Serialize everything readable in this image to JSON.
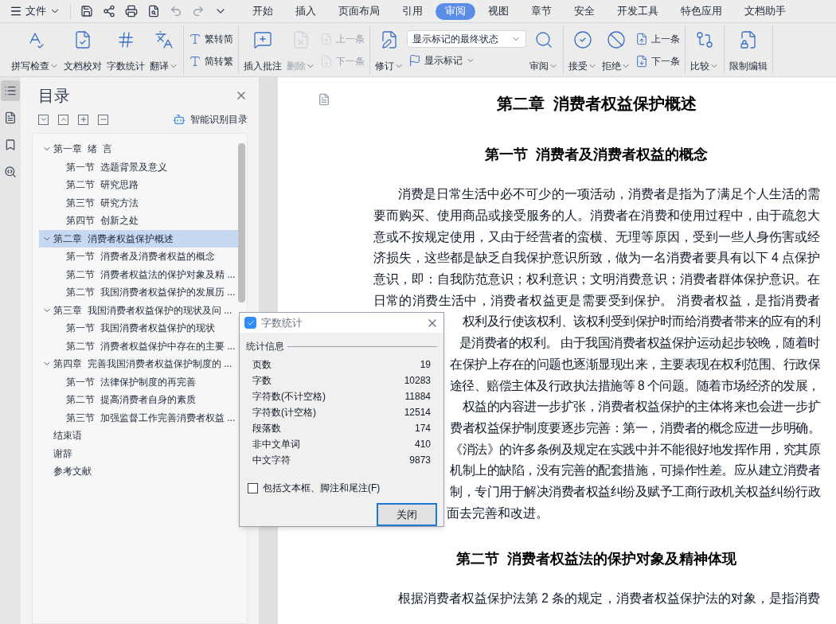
{
  "menu": {
    "file_label": "文件"
  },
  "tabs": [
    {
      "label": "开始",
      "selected": false
    },
    {
      "label": "插入",
      "selected": false
    },
    {
      "label": "页面布局",
      "selected": false
    },
    {
      "label": "引用",
      "selected": false
    },
    {
      "label": "审阅",
      "selected": true
    },
    {
      "label": "视图",
      "selected": false
    },
    {
      "label": "章节",
      "selected": false
    },
    {
      "label": "安全",
      "selected": false
    },
    {
      "label": "开发工具",
      "selected": false
    },
    {
      "label": "特色应用",
      "selected": false
    },
    {
      "label": "文档助手",
      "selected": false
    }
  ],
  "ribbon": [
    {
      "items": [
        {
          "kind": "large",
          "label": "拼写检查",
          "dropdown": true,
          "disabled": false
        },
        {
          "kind": "large",
          "label": "文档校对",
          "dropdown": false,
          "disabled": false
        },
        {
          "kind": "large",
          "label": "字数统计",
          "dropdown": false,
          "disabled": false
        },
        {
          "kind": "large",
          "label": "翻译",
          "dropdown": true,
          "disabled": false
        }
      ]
    },
    {
      "items": [
        {
          "kind": "small",
          "label": "繁转简",
          "dropdown": false,
          "disabled": false
        },
        {
          "kind": "small",
          "label": "简转繁",
          "dropdown": false,
          "disabled": false
        }
      ]
    },
    {
      "items": [
        {
          "kind": "large",
          "label": "插入批注",
          "dropdown": false,
          "disabled": false
        },
        {
          "kind": "large",
          "label": "删除",
          "dropdown": true,
          "disabled": true
        },
        {
          "kind": "small",
          "label": "上一条",
          "dropdown": false,
          "disabled": true
        },
        {
          "kind": "small",
          "label": "下一条",
          "dropdown": false,
          "disabled": true
        }
      ]
    },
    {
      "items": [
        {
          "kind": "large",
          "label": "修订",
          "dropdown": true,
          "disabled": false
        },
        {
          "kind": "select",
          "label": "显示标记的最终状态",
          "dropdown": true,
          "disabled": false
        },
        {
          "kind": "small",
          "label": "显示标记",
          "dropdown": true,
          "disabled": false
        },
        {
          "kind": "large",
          "label": "审阅",
          "dropdown": true,
          "disabled": false
        }
      ]
    },
    {
      "items": [
        {
          "kind": "large",
          "label": "接受",
          "dropdown": true,
          "disabled": false
        },
        {
          "kind": "large",
          "label": "拒绝",
          "dropdown": true,
          "disabled": false
        },
        {
          "kind": "small",
          "label": "上一条",
          "dropdown": false,
          "disabled": false
        },
        {
          "kind": "small",
          "label": "下一条",
          "dropdown": false,
          "disabled": false
        }
      ]
    },
    {
      "items": [
        {
          "kind": "large",
          "label": "比较",
          "dropdown": true,
          "disabled": false
        }
      ]
    },
    {
      "items": [
        {
          "kind": "large",
          "label": "限制编辑",
          "dropdown": false,
          "disabled": false
        }
      ]
    }
  ],
  "rail": [
    {
      "selected": true
    },
    {
      "selected": false
    },
    {
      "selected": false
    },
    {
      "selected": false
    }
  ],
  "toc": {
    "title": "目录",
    "smart_label": "智能识别目录",
    "items": [
      {
        "label": "第一章  绪  言",
        "selected": false,
        "expanded": true,
        "children": [
          {
            "label": "第一节  选题背景及意义",
            "selected": false
          },
          {
            "label": "第二节  研究思路",
            "selected": false
          },
          {
            "label": "第三节  研究方法",
            "selected": false
          },
          {
            "label": "第四节  创新之处",
            "selected": false
          }
        ]
      },
      {
        "label": "第二章  消费者权益保护概述",
        "selected": true,
        "expanded": true,
        "children": [
          {
            "label": "第一节  消费者及消费者权益的概念",
            "selected": false
          },
          {
            "label": "第二节  消费者权益法的保护对象及精 ...",
            "selected": false
          },
          {
            "label": "第二节  我国消费者权益保护的发展历 ...",
            "selected": false
          }
        ]
      },
      {
        "label": "第三章  我国消费者权益保护的现状及问 ...",
        "selected": false,
        "expanded": true,
        "children": [
          {
            "label": "第一节  我国消费者权益保护的现状",
            "selected": false
          },
          {
            "label": "第二节  消费者权益保护中存在的主要 ...",
            "selected": false
          }
        ]
      },
      {
        "label": "第四章  完善我国消费者权益保护制度的 ...",
        "selected": false,
        "expanded": true,
        "children": [
          {
            "label": "第一节  法律保护制度的再完善",
            "selected": false
          },
          {
            "label": "第二节  提高消费者自身的素质",
            "selected": false
          },
          {
            "label": "第三节  加强监督工作完善消费者权益 ...",
            "selected": false
          }
        ]
      },
      {
        "label": "结束语",
        "selected": false
      },
      {
        "label": "谢辞",
        "selected": false
      },
      {
        "label": "参考文献",
        "selected": false
      }
    ]
  },
  "document": [
    {
      "kind": "h1",
      "text": "第二章  消费者权益保护概述"
    },
    {
      "kind": "h2",
      "text": "第一节  消费者及消费者权益的概念"
    },
    {
      "kind": "para",
      "lines": [
        {
          "kind": "first",
          "text": "消费是日常生活中必不可少的一项活动，消费者是指为了满足个人生活的需"
        },
        {
          "kind": "full",
          "text": "要而购买、使用商品或接受服务的人。消费者在消费和使用过程中，由于疏忽大"
        },
        {
          "kind": "full",
          "text": "意或不按规定使用，又由于经营者的蛮横、无理等原因，受到一些人身伤害或经"
        },
        {
          "kind": "full",
          "text": "济损失，这些都是缺乏自我保护意识所致，做为一名消费者要具有以下 4 点保护"
        },
        {
          "kind": "full",
          "text": "意识，即：自我防范意识；权利意识；文明消费意识；消费者群体保护意识。在"
        },
        {
          "kind": "full",
          "text": "日常的消费生活中，消费者权益更是需要受到保护。 消费者权益，是指消费者"
        },
        {
          "kind": "covered",
          "text": "权利及行使该权利、该权利受到保护时而给消费者带来的应有的利"
        },
        {
          "kind": "covered",
          "text": "是消费者的权利。 由于我国消费者权益保护运动起步较晚，随着时"
        },
        {
          "kind": "covered",
          "text": "在保护上存在的问题也逐渐显现出来，主要表现在权利范围、行政保"
        },
        {
          "kind": "covered",
          "text": "途径、赔偿主体及行政执法措施等 8 个问题。随着市场经济的发展，"
        },
        {
          "kind": "covered",
          "text": "权益的内容进一步扩张，消费者权益保护的主体将来也会进一步扩"
        },
        {
          "kind": "covered",
          "text": "费者权益保护制度要逐步完善：第一，消费者的概念应进一步明确。"
        },
        {
          "kind": "covered",
          "text": "《消法》的许多条例及规定在实践中并不能很好地发挥作用，究其原"
        },
        {
          "kind": "covered",
          "text": "机制上的缺陷，没有完善的配套措施，可操作性差。应从建立消费者"
        },
        {
          "kind": "covered",
          "text": "制，专门用于解决消费者权益纠纷及赋予工商行政机关权益纠纷行政"
        },
        {
          "kind": "tail",
          "text": "面去完善和改进。"
        }
      ]
    },
    {
      "kind": "h2",
      "text": "第二节  消费者权益法的保护对象及精神体现"
    },
    {
      "kind": "para",
      "lines": [
        {
          "kind": "first",
          "text": "根据消费者权益保护法第 2 条的规定，消费者权益保护法的对象，是指消费"
        }
      ]
    }
  ],
  "dialog": {
    "title": "字数统计",
    "group": "统计信息",
    "rows": [
      {
        "label": "页数",
        "value": "19"
      },
      {
        "label": "字数",
        "value": "10283"
      },
      {
        "label": "字符数(不计空格)",
        "value": "11884"
      },
      {
        "label": "字符数(计空格)",
        "value": "12514"
      },
      {
        "label": "段落数",
        "value": "174"
      },
      {
        "label": "非中文单词",
        "value": "410"
      },
      {
        "label": "中文字符",
        "value": "9873"
      }
    ],
    "checkbox": {
      "label": "包括文本框、脚注和尾注(F)",
      "checked": false
    },
    "button": "关闭"
  }
}
